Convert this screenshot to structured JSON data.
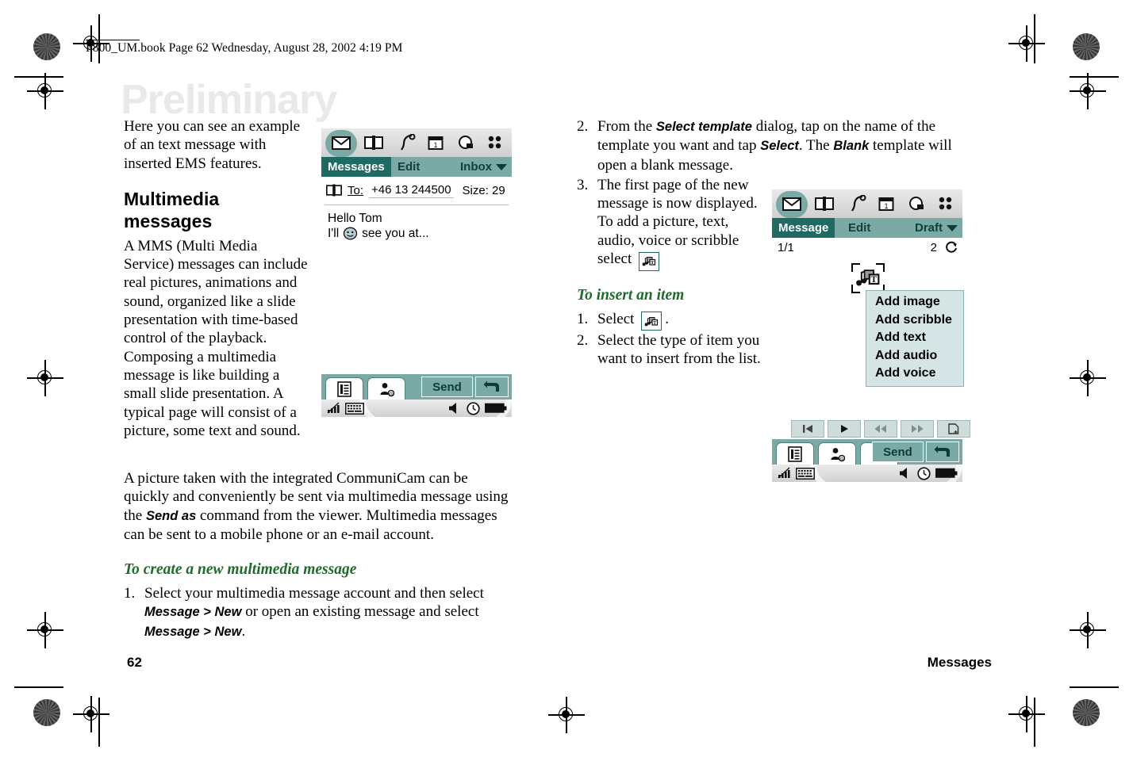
{
  "page": {
    "header_line": "P800_UM.book  Page 62  Wednesday, August 28, 2002  4:19 PM",
    "watermark": "Preliminary",
    "page_number": "62",
    "chapter": "Messages"
  },
  "left_column": {
    "intro_paragraph": "Here you can see an example of an text message with inserted EMS features.",
    "heading": "Multimedia messages",
    "body_paragraph": "A MMS (Multi Media Service) messages can include real pictures, animations and sound, organized like a slide presentation with time-based control of the playback. Composing a multimedia message is like building a small slide presentation. A typical page will consist of a picture, some text and sound."
  },
  "wide_block": {
    "paragraph_part1": "A picture taken with the integrated CommuniCam can be quickly and conveniently be sent via multimedia message using the ",
    "paragraph_bold1": "Send as",
    "paragraph_part2": " command from the viewer. Multimedia messages can be sent to a mobile phone or an e-mail account.",
    "procedure_heading": "To create a new multimedia message",
    "step1_num": "1.",
    "step1_part1": "Select your multimedia message account and then select ",
    "step1_bold1": "Message > New",
    "step1_part2": " or open an existing message and select ",
    "step1_bold2": "Message > New",
    "step1_part3": "."
  },
  "right_column": {
    "step2_num": "2.",
    "step2_part1": "From the ",
    "step2_bold1": "Select template",
    "step2_part2": " dialog, tap on the name of the template you want and tap ",
    "step2_bold2": "Select",
    "step2_part3": ". The ",
    "step2_bold3": "Blank",
    "step2_part4": " template will open a blank message.",
    "step3_num": "3.",
    "step3_text": "The first page of the new message is now displayed. To add a picture, text, audio, voice or scribble select",
    "insert_heading": "To insert an item",
    "insert_step1_num": "1.",
    "insert_step1_text": "Select",
    "insert_step1_tail": ".",
    "insert_step2_num": "2.",
    "insert_step2_text": "Select the type of item you want to insert from the list."
  },
  "phone_sms": {
    "icons": [
      "envelope-icon",
      "contacts-icon",
      "phone-icon",
      "calendar-icon",
      "search-icon",
      "apps-icon"
    ],
    "tab_active": "Messages",
    "tab_edit": "Edit",
    "folder": "Inbox",
    "to_label": "To:",
    "to_value": "+46 13 244500",
    "size_label": "Size: 29",
    "body_line1": "Hello Tom",
    "body_line2_pre": "I'll",
    "body_line2_post": "see you at...",
    "send_label": "Send",
    "back_label": "back-arrow-icon"
  },
  "phone_mms": {
    "icons": [
      "envelope-icon",
      "contacts-icon",
      "phone-icon",
      "calendar-icon",
      "search-icon",
      "apps-icon"
    ],
    "tab_active": "Message",
    "tab_edit": "Edit",
    "folder": "Draft",
    "page_indicator": "1/1",
    "duration": "2",
    "menu_items": [
      "Add image",
      "Add scribble",
      "Add text",
      "Add audio",
      "Add voice"
    ],
    "media_buttons": [
      "skip-start-icon",
      "play-icon",
      "rewind-icon",
      "fast-forward-icon",
      "new-page-icon"
    ],
    "send_label": "Send",
    "back_label": "back-arrow-icon"
  },
  "colors": {
    "teal_dark": "#1f6b63",
    "teal_mid": "#7ba9a5",
    "menu_bg": "#d5e4e4",
    "green_heading": "#1e6b2e",
    "watermark": "#e9e9e9"
  }
}
